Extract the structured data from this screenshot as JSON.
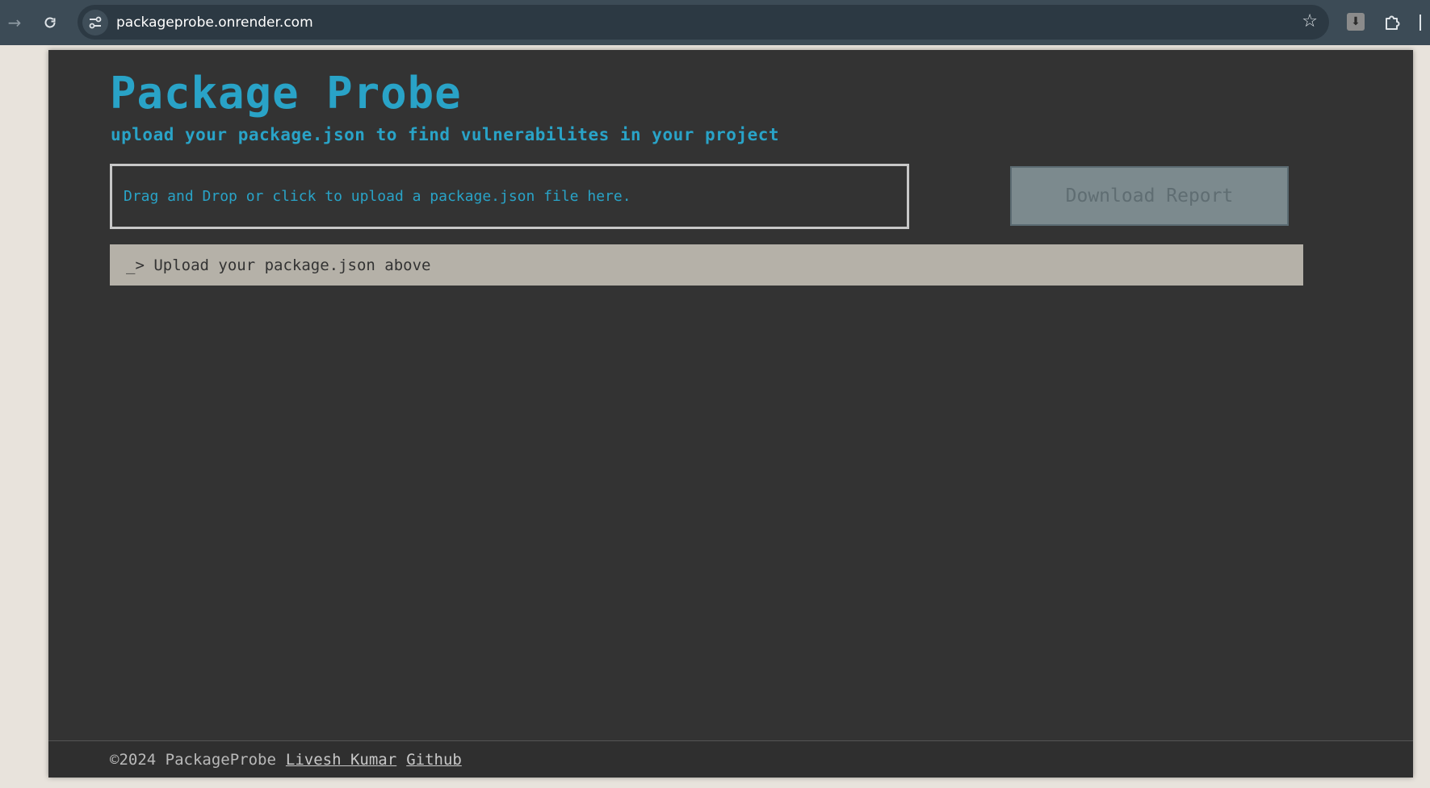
{
  "browser": {
    "url": "packageprobe.onrender.com",
    "forward_icon": "arrow-right-icon",
    "reload_icon": "reload-icon",
    "site_info_icon": "tune-icon",
    "bookmark_icon": "star-icon",
    "extensions_icon": "puzzle-icon"
  },
  "header": {
    "title": "Package Probe",
    "subtitle": "upload your package.json to find vulnerabilites in your project"
  },
  "upload": {
    "dropzone_text": "Drag and Drop or click to upload a package.json file here."
  },
  "actions": {
    "download_label": "Download Report",
    "download_enabled": false
  },
  "console": {
    "message": "_> Upload your package.json above"
  },
  "footer": {
    "copyright": "©2024 PackageProbe",
    "author_link": "Livesh Kumar",
    "github_link": "Github"
  },
  "colors": {
    "accent": "#29a3c7",
    "page_background": "#333333",
    "console_background": "#b5b1a8",
    "disabled_button": "#7c8a8e",
    "browser_bar": "#3c4b56"
  }
}
